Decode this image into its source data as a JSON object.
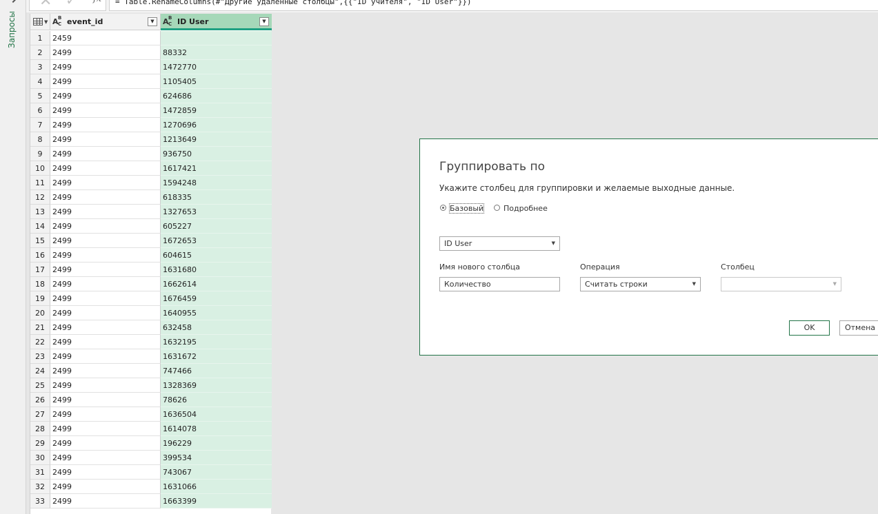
{
  "queries_pane": {
    "label": "Запросы"
  },
  "formula_bar": {
    "fx": "fx",
    "formula": "= Table.RenameColumns(#\"Другие удаленные столбцы\",{{\"ID учителя\", \"ID User\"}})"
  },
  "grid": {
    "columns": [
      {
        "name": "event_id",
        "type": "ABC"
      },
      {
        "name": "ID User",
        "type": "ABC"
      }
    ],
    "rows": [
      {
        "n": "1",
        "event_id": "2459",
        "id_user": ""
      },
      {
        "n": "2",
        "event_id": "2499",
        "id_user": "88332"
      },
      {
        "n": "3",
        "event_id": "2499",
        "id_user": "1472770"
      },
      {
        "n": "4",
        "event_id": "2499",
        "id_user": "1105405"
      },
      {
        "n": "5",
        "event_id": "2499",
        "id_user": "624686"
      },
      {
        "n": "6",
        "event_id": "2499",
        "id_user": "1472859"
      },
      {
        "n": "7",
        "event_id": "2499",
        "id_user": "1270696"
      },
      {
        "n": "8",
        "event_id": "2499",
        "id_user": "1213649"
      },
      {
        "n": "9",
        "event_id": "2499",
        "id_user": "936750"
      },
      {
        "n": "10",
        "event_id": "2499",
        "id_user": "1617421"
      },
      {
        "n": "11",
        "event_id": "2499",
        "id_user": "1594248"
      },
      {
        "n": "12",
        "event_id": "2499",
        "id_user": "618335"
      },
      {
        "n": "13",
        "event_id": "2499",
        "id_user": "1327653"
      },
      {
        "n": "14",
        "event_id": "2499",
        "id_user": "605227"
      },
      {
        "n": "15",
        "event_id": "2499",
        "id_user": "1672653"
      },
      {
        "n": "16",
        "event_id": "2499",
        "id_user": "604615"
      },
      {
        "n": "17",
        "event_id": "2499",
        "id_user": "1631680"
      },
      {
        "n": "18",
        "event_id": "2499",
        "id_user": "1662614"
      },
      {
        "n": "19",
        "event_id": "2499",
        "id_user": "1676459"
      },
      {
        "n": "20",
        "event_id": "2499",
        "id_user": "1640955"
      },
      {
        "n": "21",
        "event_id": "2499",
        "id_user": "632458"
      },
      {
        "n": "22",
        "event_id": "2499",
        "id_user": "1632195"
      },
      {
        "n": "23",
        "event_id": "2499",
        "id_user": "1631672"
      },
      {
        "n": "24",
        "event_id": "2499",
        "id_user": "747466"
      },
      {
        "n": "25",
        "event_id": "2499",
        "id_user": "1328369"
      },
      {
        "n": "26",
        "event_id": "2499",
        "id_user": "78626"
      },
      {
        "n": "27",
        "event_id": "2499",
        "id_user": "1636504"
      },
      {
        "n": "28",
        "event_id": "2499",
        "id_user": "1614078"
      },
      {
        "n": "29",
        "event_id": "2499",
        "id_user": "196229"
      },
      {
        "n": "30",
        "event_id": "2499",
        "id_user": "399534"
      },
      {
        "n": "31",
        "event_id": "2499",
        "id_user": "743067"
      },
      {
        "n": "32",
        "event_id": "2499",
        "id_user": "1631066"
      },
      {
        "n": "33",
        "event_id": "2499",
        "id_user": "1663399"
      }
    ]
  },
  "dialog": {
    "title": "Группировать по",
    "subtitle": "Укажите столбец для группировки и желаемые выходные данные.",
    "radio_basic": "Базовый",
    "radio_advanced": "Подробнее",
    "group_column": "ID User",
    "new_column_label": "Имя нового столбца",
    "new_column_value": "Количество",
    "operation_label": "Операция",
    "operation_value": "Считать строки",
    "column_label": "Столбец",
    "column_value": "",
    "ok": "OK",
    "cancel": "Отмена"
  },
  "colors": {
    "accent": "#217346",
    "selected_column_header": "#a6d8b9",
    "selected_column_cells": "#d9f0e3"
  }
}
